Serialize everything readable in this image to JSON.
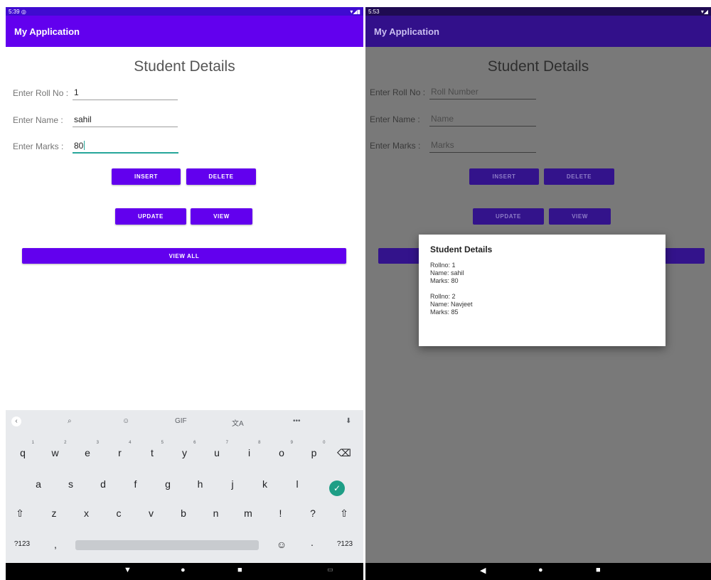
{
  "left_screen": {
    "status_time": "5:39",
    "app_title": "My Application",
    "heading": "Student Details",
    "fields": {
      "roll": {
        "label": "Enter Roll No :",
        "value": "1"
      },
      "name": {
        "label": "Enter Name   :",
        "value": "sahil"
      },
      "marks": {
        "label": "Enter Marks   :",
        "value": "80"
      }
    },
    "buttons": {
      "insert": "INSERT",
      "delete": "DELETE",
      "update": "UPDATE",
      "view": "VIEW",
      "view_all": "VIEW ALL"
    },
    "keyboard": {
      "toolbar": {
        "search": "⌕",
        "sticker": "☺",
        "gif": "GIF",
        "translate": "文A",
        "more": "•••",
        "mic": "🎤"
      },
      "row1": [
        "q",
        "w",
        "e",
        "r",
        "t",
        "y",
        "u",
        "i",
        "o",
        "p"
      ],
      "row1_hints": [
        "1",
        "2",
        "3",
        "4",
        "5",
        "6",
        "7",
        "8",
        "9",
        "0"
      ],
      "row2": [
        "a",
        "s",
        "d",
        "f",
        "g",
        "h",
        "j",
        "k",
        "l"
      ],
      "row3": [
        "z",
        "x",
        "c",
        "v",
        "b",
        "n",
        "m",
        "!",
        "?"
      ],
      "symbols_key": "?123",
      "comma_key": ",",
      "period_key": "·",
      "symbols_key_right": "?123"
    }
  },
  "right_screen": {
    "status_time": "5:53",
    "app_title": "My Application",
    "heading": "Student Details",
    "fields": {
      "roll": {
        "label": "Enter Roll No :",
        "placeholder": "Roll Number"
      },
      "name": {
        "label": "Enter Name   :",
        "placeholder": "Name"
      },
      "marks": {
        "label": "Enter Marks   :",
        "placeholder": "Marks"
      }
    },
    "buttons": {
      "insert": "INSERT",
      "delete": "DELETE",
      "update": "UPDATE",
      "view": "VIEW"
    },
    "dialog": {
      "title": "Student Details",
      "records": [
        {
          "rollno": "Rollno: 1",
          "name": "Name: sahil",
          "marks": "Marks: 80"
        },
        {
          "rollno": "Rollno: 2",
          "name": "Name: Navjeet",
          "marks": "Marks: 85"
        }
      ]
    }
  },
  "colors": {
    "primary": "#6200ee",
    "status_bar": "#3f0bd0",
    "focus_accent": "#26a69a",
    "scrim": "#797979"
  }
}
